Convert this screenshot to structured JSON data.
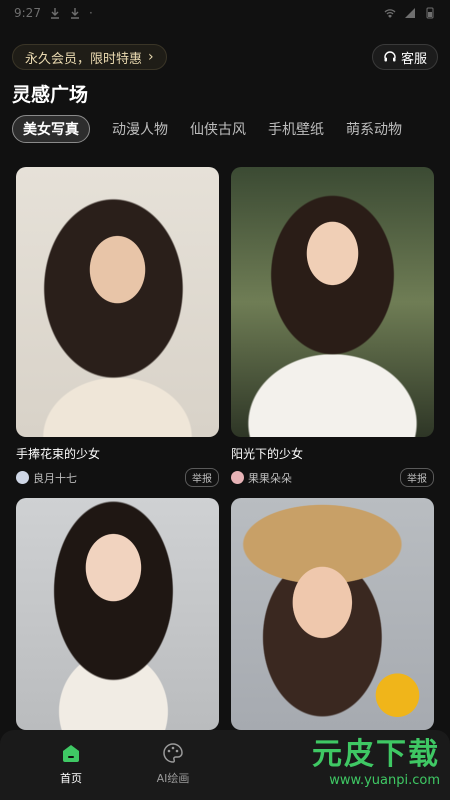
{
  "status": {
    "time": "9:27"
  },
  "vip": {
    "label": "永久会员，限时特惠",
    "chevron": "›"
  },
  "service": {
    "label": "客服",
    "icon": "headset-icon"
  },
  "section": {
    "title": "灵感广场"
  },
  "tabs": [
    {
      "label": "美女写真",
      "active": true
    },
    {
      "label": "动漫人物"
    },
    {
      "label": "仙侠古风"
    },
    {
      "label": "手机壁纸"
    },
    {
      "label": "萌系动物"
    }
  ],
  "cards": [
    {
      "caption": "手捧花束的少女",
      "author": "良月十七",
      "report": "举报"
    },
    {
      "caption": "阳光下的少女",
      "author": "果果朵朵",
      "report": "举报"
    },
    {
      "caption": "",
      "author": "",
      "report": ""
    },
    {
      "caption": "",
      "author": "",
      "report": ""
    }
  ],
  "nav": {
    "home": "首页",
    "ai": "AI绘画"
  },
  "watermark": {
    "main": "元皮下载",
    "sub": "www.yuanpi.com"
  },
  "colors": {
    "accent": "#3fc864",
    "vip_text": "#e9d9b0",
    "background": "#111111"
  }
}
